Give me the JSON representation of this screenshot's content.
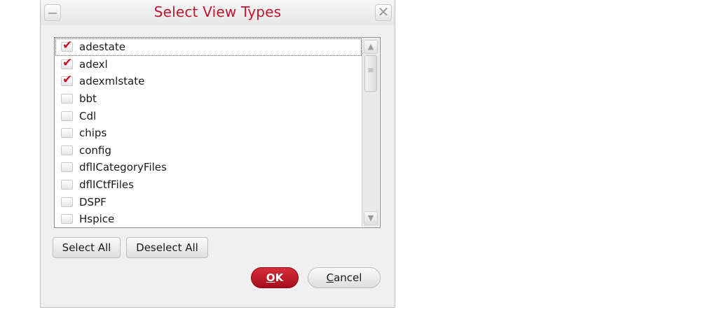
{
  "dialog": {
    "title": "Select View Types",
    "close_glyph": "✕",
    "minimize_icon": "minimize-icon"
  },
  "view_types": [
    {
      "label": "adestate",
      "checked": true,
      "focused": true
    },
    {
      "label": "adexl",
      "checked": true
    },
    {
      "label": "adexmlstate",
      "checked": true
    },
    {
      "label": "bbt",
      "checked": false
    },
    {
      "label": "Cdl",
      "checked": false
    },
    {
      "label": "chips",
      "checked": false
    },
    {
      "label": "config",
      "checked": false
    },
    {
      "label": "dflICategoryFiles",
      "checked": false
    },
    {
      "label": "dflICtfFiles",
      "checked": false
    },
    {
      "label": "DSPF",
      "checked": false
    },
    {
      "label": "Hspice",
      "checked": false
    }
  ],
  "scrollbar": {
    "up_glyph": "▲",
    "down_glyph": "▼"
  },
  "buttons": {
    "select_all": "Select All",
    "deselect_all": "Deselect All",
    "ok_mnemonic": "O",
    "ok_rest": "K",
    "cancel_mnemonic": "C",
    "cancel_rest": "ancel"
  },
  "colors": {
    "title": "#c0162d",
    "check": "#c8102e",
    "ok_button": "#c0162d"
  }
}
